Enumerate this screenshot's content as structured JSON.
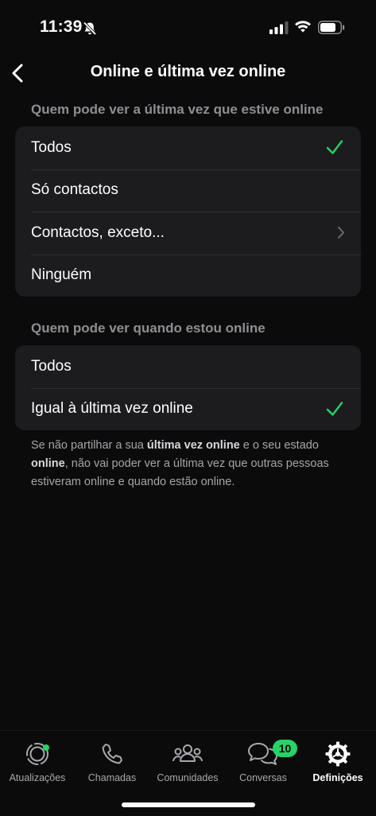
{
  "status_bar": {
    "time": "11:39"
  },
  "nav": {
    "title": "Online e última vez online"
  },
  "last_seen": {
    "header": "Quem pode ver a última vez que estive online",
    "options": [
      {
        "label": "Todos",
        "selected": true
      },
      {
        "label": "Só contactos",
        "selected": false
      },
      {
        "label": "Contactos, exceto...",
        "selected": false
      },
      {
        "label": "Ninguém",
        "selected": false
      }
    ]
  },
  "online": {
    "header": "Quem pode ver quando estou online",
    "options": [
      {
        "label": "Todos",
        "selected": false
      },
      {
        "label": "Igual à última vez online",
        "selected": true
      }
    ]
  },
  "footnote": {
    "part1": "Se não partilhar a sua ",
    "bold1": "última vez online",
    "part2": " e o seu estado ",
    "bold2": "online",
    "part3": ", não vai poder ver a última vez que outras pessoas estiveram online e quando estão online."
  },
  "tabs": [
    {
      "label": "Atualizações",
      "icon": "status-updates-icon"
    },
    {
      "label": "Chamadas",
      "icon": "phone-icon"
    },
    {
      "label": "Comunidades",
      "icon": "communities-icon"
    },
    {
      "label": "Conversas",
      "icon": "chat-bubbles-icon",
      "badge": "10"
    },
    {
      "label": "Definições",
      "icon": "settings-gear-icon",
      "active": true
    }
  ],
  "colors": {
    "accent": "#25d366",
    "background": "#0b0b0b",
    "group": "#1c1c1e"
  }
}
